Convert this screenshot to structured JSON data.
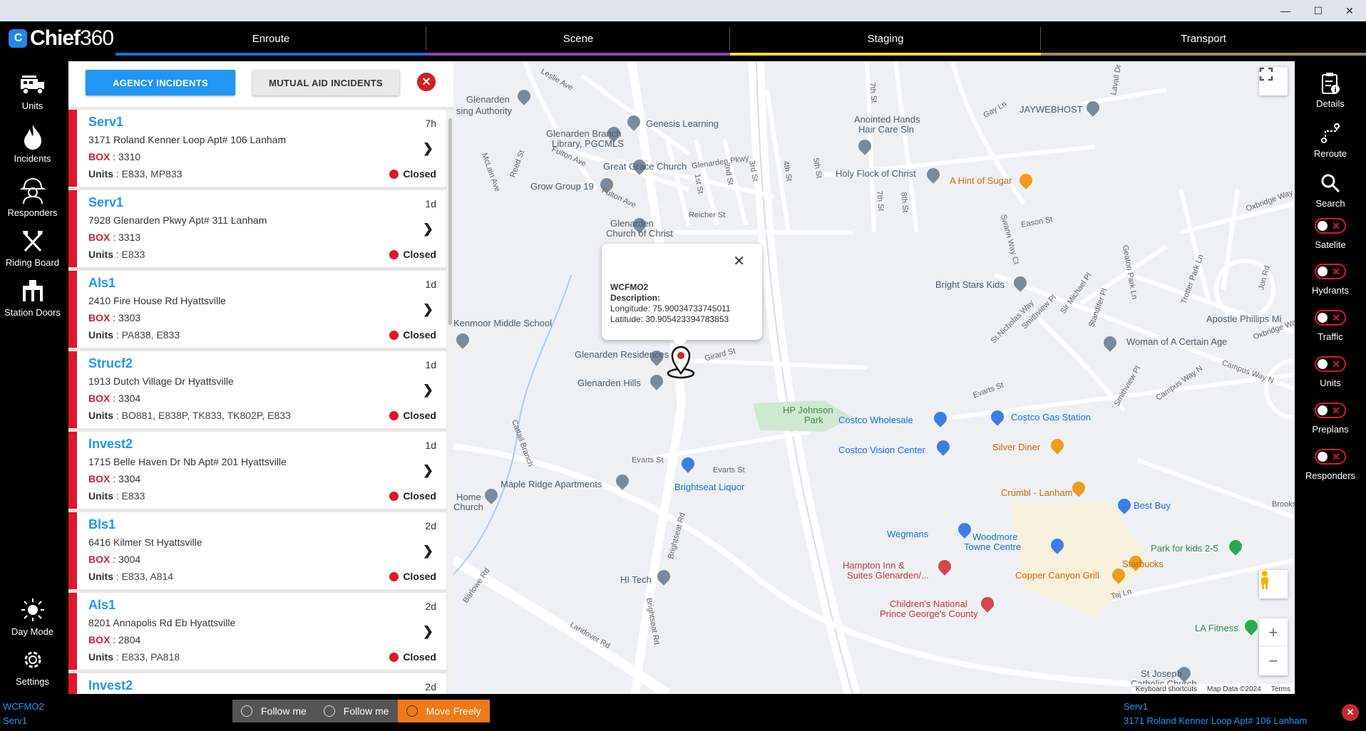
{
  "app": {
    "logo_text": "Chief",
    "logo_num": "360"
  },
  "window_controls": {
    "minimize": "—",
    "maximize": "☐",
    "close": "✕"
  },
  "tabs": [
    {
      "label": "Enroute",
      "color": "#1e6fd9"
    },
    {
      "label": "Scene",
      "color": "#8e44ad"
    },
    {
      "label": "Staging",
      "color": "#f1e11c"
    },
    {
      "label": "Transport",
      "color": "#9c8a6e"
    }
  ],
  "left_nav": {
    "units": "Units",
    "incidents": "Incidents",
    "responders": "Responders",
    "riding_board": "Riding Board",
    "station_doors": "Station Doors",
    "day_mode": "Day Mode",
    "settings": "Settings"
  },
  "panel": {
    "agency_btn": "AGENCY INCIDENTS",
    "mutual_btn": "MUTUAL AID INCIDENTS",
    "close": "✕",
    "box_label": "BOX",
    "units_label": "Units",
    "incidents": [
      {
        "name": "Serv1",
        "age": "7h",
        "address": "3171 Roland Kenner Loop Apt# 106 Lanham",
        "box": "3310",
        "units": "E833, MP833",
        "status": "Closed"
      },
      {
        "name": "Serv1",
        "age": "1d",
        "address": "7928 Glenarden Pkwy Apt# 311 Lanham",
        "box": "3313",
        "units": "E833",
        "status": "Closed"
      },
      {
        "name": "Als1",
        "age": "1d",
        "address": "2410 Fire House Rd Hyattsville",
        "box": "3303",
        "units": "PA838, E833",
        "status": "Closed"
      },
      {
        "name": "Strucf2",
        "age": "1d",
        "address": "1913 Dutch Village Dr Hyattsville",
        "box": "3304",
        "units": "BO881, E838P, TK833, TK802P, E833",
        "status": "Closed"
      },
      {
        "name": "Invest2",
        "age": "1d",
        "address": "1715 Belle Haven Dr Nb Apt# 201 Hyattsville",
        "box": "3304",
        "units": "E833",
        "status": "Closed"
      },
      {
        "name": "Bls1",
        "age": "2d",
        "address": "6416 Kilmer St Hyattsville",
        "box": "3004",
        "units": "E833, A814",
        "status": "Closed"
      },
      {
        "name": "Als1",
        "age": "2d",
        "address": "8201 Annapolis Rd Eb Hyattsville",
        "box": "2804",
        "units": "E833, PA818",
        "status": "Closed"
      },
      {
        "name": "Invest2",
        "age": "2d",
        "address": "",
        "box": "",
        "units": "",
        "status": ""
      }
    ]
  },
  "map": {
    "popup": {
      "title": "WCFMO2",
      "description": "Description:",
      "longitude": "Longitude: 75.90034733745011",
      "latitude": "Latitude: 30.905423394783853",
      "close": "✕"
    },
    "footer": {
      "shortcuts": "Keyboard shortcuts",
      "data": "Map Data ©2024",
      "terms": "Terms"
    },
    "zoom_in": "+",
    "zoom_out": "−",
    "places": [
      {
        "text": "Glenarden",
        "cls": ""
      },
      {
        "text": "sing Authority",
        "cls": ""
      },
      {
        "text": "Genesis Learning",
        "cls": ""
      },
      {
        "text": "Glenarden Branch",
        "cls": ""
      },
      {
        "text": "Library, PGCMLS",
        "cls": ""
      },
      {
        "text": "Great Grace Church",
        "cls": ""
      },
      {
        "text": "Grow Group 19",
        "cls": ""
      },
      {
        "text": "Glenarden",
        "cls": ""
      },
      {
        "text": "Church of Christ",
        "cls": ""
      },
      {
        "text": "Anointed Hands",
        "cls": ""
      },
      {
        "text": "Hair Care Sln",
        "cls": ""
      },
      {
        "text": "Holy Flock of Christ",
        "cls": ""
      },
      {
        "text": "A Hint of Sugar",
        "cls": "or"
      },
      {
        "text": "JAYWEBHOST",
        "cls": ""
      },
      {
        "text": "Bright Stars Kids",
        "cls": ""
      },
      {
        "text": "Apostle Phillips Mi",
        "cls": ""
      },
      {
        "text": "Woman of A Certain Age",
        "cls": ""
      },
      {
        "text": "Kenmoor Middle School",
        "cls": ""
      },
      {
        "text": "Glenarden Residences",
        "cls": ""
      },
      {
        "text": "Glenarden Hills",
        "cls": ""
      },
      {
        "text": "HP Johnson",
        "cls": "gr"
      },
      {
        "text": "Park",
        "cls": "gr"
      },
      {
        "text": "Costco Wholesale",
        "cls": "bl"
      },
      {
        "text": "Costco Vision Center",
        "cls": "bl"
      },
      {
        "text": "Costco Gas Station",
        "cls": "bl"
      },
      {
        "text": "Silver Diner",
        "cls": "or"
      },
      {
        "text": "Brightseat Liquor",
        "cls": "bl"
      },
      {
        "text": "Maple Ridge Apartments",
        "cls": ""
      },
      {
        "text": "Home",
        "cls": ""
      },
      {
        "text": "Church",
        "cls": ""
      },
      {
        "text": "Crumbl - Lanham",
        "cls": "or"
      },
      {
        "text": "Best Buy",
        "cls": "bl"
      },
      {
        "text": "Wegmans",
        "cls": "bl"
      },
      {
        "text": "Woodmore",
        "cls": "bl"
      },
      {
        "text": "Towne Centre",
        "cls": "bl"
      },
      {
        "text": "Park for kids 2-5",
        "cls": "gr"
      },
      {
        "text": "Starbucks",
        "cls": "or"
      },
      {
        "text": "Copper Canyon Grill",
        "cls": "or"
      },
      {
        "text": "Hampton Inn &",
        "cls": "rd"
      },
      {
        "text": "Suites Glenarden/...",
        "cls": "rd"
      },
      {
        "text": "HI Tech",
        "cls": ""
      },
      {
        "text": "Children's National",
        "cls": "rd"
      },
      {
        "text": "Prince George's County",
        "cls": "rd"
      },
      {
        "text": "LA Fitness",
        "cls": "gr"
      },
      {
        "text": "St Joseph",
        "cls": ""
      },
      {
        "text": "Catholic Church",
        "cls": ""
      }
    ],
    "streets": [
      "Leslie Ave",
      "Fulton Ave",
      "Reed St",
      "McLain Ave",
      "Fulton Ave",
      "1st St",
      "2nd St",
      "3rd St",
      "4th St",
      "5th St",
      "7th St",
      "7th St",
      "8th St",
      "Glenarden Pkwy",
      "Reicher St",
      "Girard St",
      "Evarts St",
      "Evarts St",
      "Evarts St",
      "Brightseat Rd",
      "Brightseat Rd",
      "Landover Rd",
      "Barlowe Rd",
      "Cattail Branch",
      "Gay Ln",
      "Lavall Dr",
      "Eason St",
      "Swann Way Ct",
      "St Nicholas Way",
      "Smithview Pl",
      "Sir Michael Pl",
      "Standifer Pl",
      "Smithview Pl",
      "Campus Way N",
      "Oxbridge Way",
      "Oxbridge Way",
      "Taj Ln",
      "Trotter Park Ln",
      "Geaton Park Ln",
      "Brooks",
      "Campus Way N",
      "Jon Rd"
    ]
  },
  "right_nav": {
    "details": "Details",
    "reroute": "Reroute",
    "search": "Search",
    "satelite": "Satelite",
    "hydrants": "Hydrants",
    "traffic": "Traffic",
    "units": "Units",
    "preplans": "Preplans",
    "responders": "Responders"
  },
  "bottom": {
    "left_title": "WCFMO2",
    "left_sub": "Serv1",
    "follow1": "Follow me",
    "follow2": "Follow me",
    "move_freely": "Move Freely",
    "right_title": "Serv1",
    "right_sub": "3171 Roland Kenner Loop Apt# 106 Lanham",
    "close": "✕"
  }
}
